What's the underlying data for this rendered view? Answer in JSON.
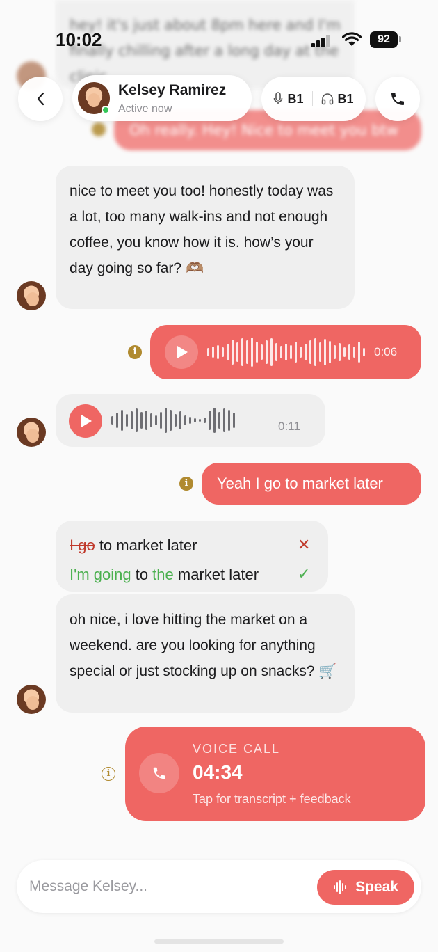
{
  "status_bar": {
    "time": "10:02",
    "battery": "92"
  },
  "blurred_context": {
    "received_text": "hey! it's just about 8pm here and I'm finally chilling after a long day at the clinic",
    "sent_text": "Oh really. Hey! Nice to meet you btw"
  },
  "header": {
    "contact_name": "Kelsey Ramirez",
    "contact_status": "Active now",
    "speaking_level": "B1",
    "listening_level": "B1"
  },
  "messages": {
    "m1_text": "nice to meet you too! honestly today was a lot, too many walk-ins and not enough coffee, you know how it is. how’s your day going so far? 🫶🏽",
    "m2_duration": "0:06",
    "m3_duration": "0:11",
    "m4_text": "Yeah I go to market later",
    "correction": {
      "wrong_strike": "I go",
      "wrong_rest": " to market later",
      "fix_part1": "I'm going",
      "fix_part2": " to ",
      "fix_part3": "the",
      "fix_part4": " market later"
    },
    "m5_text": "oh nice, i love hitting the market on a weekend. are you looking for anything special or just stocking up on snacks? 🛒",
    "call": {
      "label": "VOICE CALL",
      "duration": "04:34",
      "subtitle": "Tap for transcript + feedback"
    }
  },
  "composer": {
    "placeholder": "Message Kelsey...",
    "speak_label": "Speak"
  },
  "colors": {
    "accent": "#ef6663",
    "received_bubble": "#efefef",
    "info_icon": "#b08a2f",
    "correct_green": "#4cb050",
    "error_red": "#c0392b"
  }
}
